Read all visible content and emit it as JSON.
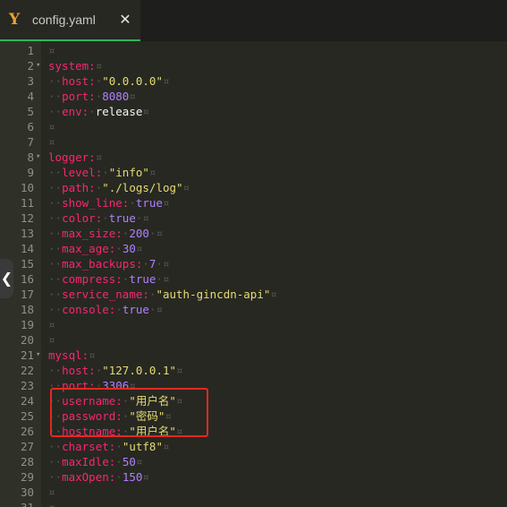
{
  "tab": {
    "title": "config.yaml",
    "icon_glyph": "Y",
    "close_glyph": "✕",
    "icon": "yaml-icon"
  },
  "side_handle": {
    "glyph": "❮"
  },
  "colors": {
    "background": "#272822",
    "key": "#f92672",
    "string": "#e6db74",
    "number": "#ae81ff",
    "plain": "#f8f8f2",
    "tab_active_underline": "#2fb35a",
    "highlight_box": "#e3291f"
  },
  "whitespace_glyph": "¤",
  "lines": [
    {
      "n": "1",
      "fold": "",
      "tokens": []
    },
    {
      "n": "2",
      "fold": "▾",
      "tokens": [
        [
          "key",
          "system:"
        ]
      ]
    },
    {
      "n": "3",
      "fold": "",
      "tokens": [
        [
          "ws",
          "··"
        ],
        [
          "key",
          "host:"
        ],
        [
          "ws",
          "·"
        ],
        [
          "str",
          "\"0.0.0.0\""
        ]
      ]
    },
    {
      "n": "4",
      "fold": "",
      "tokens": [
        [
          "ws",
          "··"
        ],
        [
          "key",
          "port:"
        ],
        [
          "ws",
          "·"
        ],
        [
          "num",
          "8080"
        ]
      ]
    },
    {
      "n": "5",
      "fold": "",
      "tokens": [
        [
          "ws",
          "··"
        ],
        [
          "key",
          "env:"
        ],
        [
          "ws",
          "·"
        ],
        [
          "plain",
          "release"
        ]
      ]
    },
    {
      "n": "6",
      "fold": "",
      "tokens": []
    },
    {
      "n": "7",
      "fold": "",
      "tokens": []
    },
    {
      "n": "8",
      "fold": "▾",
      "tokens": [
        [
          "key",
          "logger:"
        ]
      ]
    },
    {
      "n": "9",
      "fold": "",
      "tokens": [
        [
          "ws",
          "··"
        ],
        [
          "key",
          "level:"
        ],
        [
          "ws",
          "·"
        ],
        [
          "str",
          "\"info\""
        ]
      ]
    },
    {
      "n": "10",
      "fold": "",
      "tokens": [
        [
          "ws",
          "··"
        ],
        [
          "key",
          "path:"
        ],
        [
          "ws",
          "·"
        ],
        [
          "str",
          "\"./logs/log\""
        ]
      ]
    },
    {
      "n": "11",
      "fold": "",
      "tokens": [
        [
          "ws",
          "··"
        ],
        [
          "key",
          "show_line:"
        ],
        [
          "ws",
          "·"
        ],
        [
          "bool",
          "true"
        ]
      ]
    },
    {
      "n": "12",
      "fold": "",
      "tokens": [
        [
          "ws",
          "··"
        ],
        [
          "key",
          "color:"
        ],
        [
          "ws",
          "·"
        ],
        [
          "bool",
          "true"
        ],
        [
          "ws",
          "·"
        ]
      ]
    },
    {
      "n": "13",
      "fold": "",
      "tokens": [
        [
          "ws",
          "··"
        ],
        [
          "key",
          "max_size:"
        ],
        [
          "ws",
          "·"
        ],
        [
          "num",
          "200"
        ],
        [
          "ws",
          "·"
        ]
      ]
    },
    {
      "n": "14",
      "fold": "",
      "tokens": [
        [
          "ws",
          "··"
        ],
        [
          "key",
          "max_age:"
        ],
        [
          "ws",
          "·"
        ],
        [
          "num",
          "30"
        ]
      ]
    },
    {
      "n": "15",
      "fold": "",
      "tokens": [
        [
          "ws",
          "··"
        ],
        [
          "key",
          "max_backups:"
        ],
        [
          "ws",
          "·"
        ],
        [
          "num",
          "7"
        ],
        [
          "ws",
          "·"
        ]
      ]
    },
    {
      "n": "16",
      "fold": "",
      "tokens": [
        [
          "ws",
          "··"
        ],
        [
          "key",
          "compress:"
        ],
        [
          "ws",
          "·"
        ],
        [
          "bool",
          "true"
        ],
        [
          "ws",
          "·"
        ]
      ]
    },
    {
      "n": "17",
      "fold": "",
      "tokens": [
        [
          "ws",
          "··"
        ],
        [
          "key",
          "service_name:"
        ],
        [
          "ws",
          "·"
        ],
        [
          "str",
          "\"auth-gincdn-api\""
        ]
      ]
    },
    {
      "n": "18",
      "fold": "",
      "tokens": [
        [
          "ws",
          "··"
        ],
        [
          "key",
          "console:"
        ],
        [
          "ws",
          "·"
        ],
        [
          "bool",
          "true"
        ],
        [
          "ws",
          "·"
        ]
      ]
    },
    {
      "n": "19",
      "fold": "",
      "tokens": []
    },
    {
      "n": "20",
      "fold": "",
      "tokens": []
    },
    {
      "n": "21",
      "fold": "▾",
      "tokens": [
        [
          "key",
          "mysql:"
        ]
      ]
    },
    {
      "n": "22",
      "fold": "",
      "tokens": [
        [
          "ws",
          "··"
        ],
        [
          "key",
          "host:"
        ],
        [
          "ws",
          "·"
        ],
        [
          "str",
          "\"127.0.0.1\""
        ]
      ]
    },
    {
      "n": "23",
      "fold": "",
      "tokens": [
        [
          "ws",
          "··"
        ],
        [
          "key",
          "port:"
        ],
        [
          "ws",
          "·"
        ],
        [
          "num",
          "3306"
        ]
      ]
    },
    {
      "n": "24",
      "fold": "",
      "tokens": [
        [
          "ws",
          "··"
        ],
        [
          "key",
          "username:"
        ],
        [
          "ws",
          "·"
        ],
        [
          "str",
          "\"用户名\""
        ]
      ]
    },
    {
      "n": "25",
      "fold": "",
      "tokens": [
        [
          "ws",
          "··"
        ],
        [
          "key",
          "password:"
        ],
        [
          "ws",
          "·"
        ],
        [
          "str",
          "\"密码\""
        ]
      ]
    },
    {
      "n": "26",
      "fold": "",
      "tokens": [
        [
          "ws",
          "··"
        ],
        [
          "key",
          "hostname:"
        ],
        [
          "ws",
          "·"
        ],
        [
          "str",
          "\"用户名\""
        ]
      ]
    },
    {
      "n": "27",
      "fold": "",
      "tokens": [
        [
          "ws",
          "··"
        ],
        [
          "key",
          "charset:"
        ],
        [
          "ws",
          "·"
        ],
        [
          "str",
          "\"utf8\""
        ]
      ]
    },
    {
      "n": "28",
      "fold": "",
      "tokens": [
        [
          "ws",
          "··"
        ],
        [
          "key",
          "maxIdle:"
        ],
        [
          "ws",
          "·"
        ],
        [
          "num",
          "50"
        ]
      ]
    },
    {
      "n": "29",
      "fold": "",
      "tokens": [
        [
          "ws",
          "··"
        ],
        [
          "key",
          "maxOpen:"
        ],
        [
          "ws",
          "·"
        ],
        [
          "num",
          "150"
        ]
      ]
    },
    {
      "n": "30",
      "fold": "",
      "tokens": []
    },
    {
      "n": "31",
      "fold": "",
      "tokens": []
    }
  ]
}
